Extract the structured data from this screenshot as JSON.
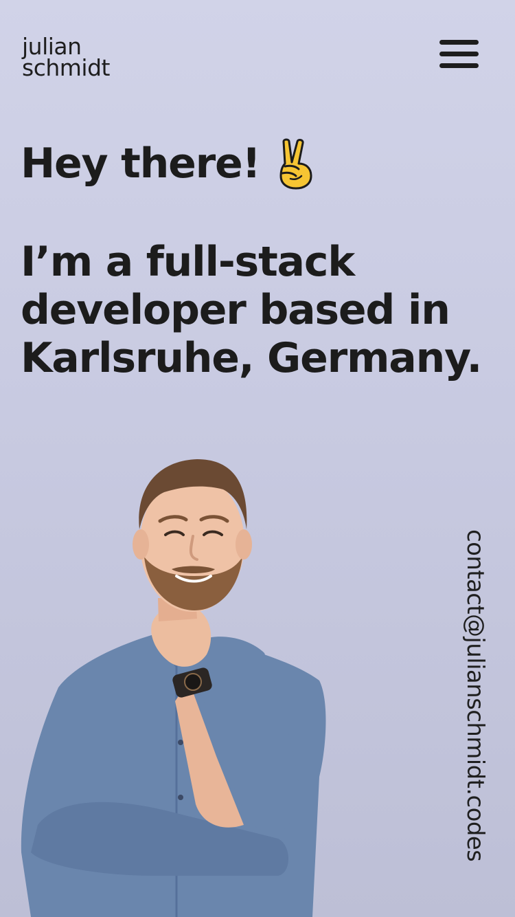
{
  "header": {
    "logo_line1": "julian",
    "logo_line2": "schmidt",
    "menu_icon": "hamburger-menu-icon"
  },
  "hero": {
    "greeting": "Hey there!",
    "greeting_icon": "victory-hand-emoji",
    "intro_line1": "I’m a full-stack",
    "intro_line2": "developer based in",
    "intro_line3": "Karlsruhe, Germany."
  },
  "contact": {
    "email": "contact@julianschmidt.codes"
  },
  "colors": {
    "background_top": "#d1d3e8",
    "background_bottom": "#bdbfd6",
    "text": "#1c1c1c",
    "shirt": "#6a86ad",
    "emoji": "#f6c533"
  }
}
